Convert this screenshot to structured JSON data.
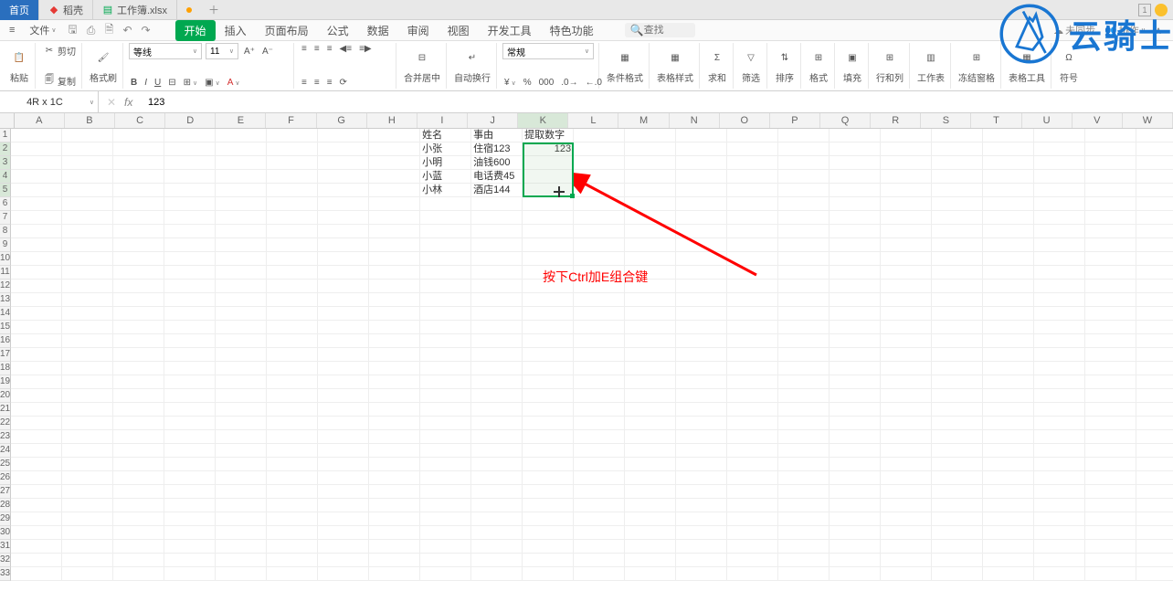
{
  "tabs": {
    "home": "首页",
    "daoke": "稻壳",
    "workbook": "工作簿.xlsx"
  },
  "menu": {
    "file": "文件"
  },
  "ribbon_tabs": {
    "start": "开始",
    "insert": "插入",
    "layout": "页面布局",
    "formula": "公式",
    "data": "数据",
    "review": "审阅",
    "view": "视图",
    "dev": "开发工具",
    "special": "特色功能"
  },
  "search": {
    "placeholder": "查找"
  },
  "sync": {
    "not_synced": "未同步",
    "collab": "协作"
  },
  "ribbon": {
    "paste": "粘贴",
    "cut": "剪切",
    "copy": "复制",
    "format_painter": "格式刷",
    "font_name": "等线",
    "font_size": "11",
    "merge": "合并居中",
    "auto_wrap": "自动换行",
    "number_format": "常规",
    "cond_format": "条件格式",
    "table_style": "表格样式",
    "sum": "求和",
    "filter": "筛选",
    "sort": "排序",
    "format": "格式",
    "fill": "填充",
    "row_col": "行和列",
    "worksheet": "工作表",
    "freeze": "冻结窗格",
    "table_tools": "表格工具",
    "symbol": "符号"
  },
  "name_box": "4R x 1C",
  "formula": "123",
  "annotation": "按下Ctrl加E组合键",
  "columns": [
    "A",
    "B",
    "C",
    "D",
    "E",
    "F",
    "G",
    "H",
    "I",
    "J",
    "K",
    "L",
    "M",
    "N",
    "O",
    "P",
    "Q",
    "R",
    "S",
    "T",
    "U",
    "V",
    "W"
  ],
  "data_cells": {
    "headers": {
      "name": "姓名",
      "reason": "事由",
      "extract": "提取数字"
    },
    "rows": [
      {
        "name": "小张",
        "reason": "住宿123",
        "extract": "123"
      },
      {
        "name": "小明",
        "reason": "油钱600",
        "extract": ""
      },
      {
        "name": "小蓝",
        "reason": "电话费45",
        "extract": ""
      },
      {
        "name": "小林",
        "reason": "酒店144",
        "extract": ""
      }
    ]
  },
  "watermark": "云骑士",
  "icons": {
    "doc_red": "◆",
    "doc_green": "▤",
    "plus": "+",
    "min": "▢",
    "close": "✕",
    "hamburger": "≡",
    "save": "🖫",
    "print": "⎙",
    "preview": "⿸",
    "undo": "↶",
    "redo": "↷",
    "search": "🔍",
    "cloud": "☁",
    "people": "👥",
    "chevron": "∨",
    "scissors": "✂",
    "clipboard": "📋",
    "brush": "🖌",
    "bold": "B",
    "italic": "I",
    "underline": "U",
    "strike": "abc",
    "border": "⊞",
    "fill_color": "▣",
    "font_color": "A",
    "align_l": "≡",
    "align_c": "≡",
    "align_r": "≡",
    "indent_dec": "◀",
    "indent_inc": "▶",
    "sigma": "Σ",
    "funnel": "▽",
    "sort_az": "⇅",
    "cell_fmt": "⊞",
    "bucket": "▣",
    "rows_cols": "⊞",
    "sheet": "▥",
    "freeze": "❄",
    "tools": "▦",
    "omega": "Ω"
  }
}
